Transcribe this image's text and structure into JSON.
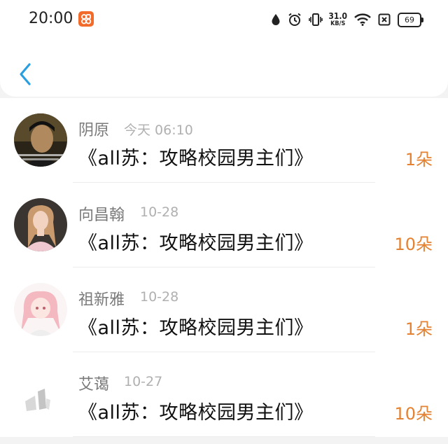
{
  "status_bar": {
    "time": "20:00",
    "net_speed_value": "31.0",
    "net_speed_unit": "KB/S",
    "battery": "69",
    "icons": [
      "app-icon",
      "water-drop-icon",
      "alarm-icon",
      "vibrate-icon",
      "wifi-icon",
      "sim-off-icon",
      "battery-icon"
    ],
    "app_icon_color": "#f26b2a"
  },
  "nav": {
    "back_icon": "chevron-left-icon",
    "accent": "#2a9fe0"
  },
  "records": [
    {
      "name": "阴原",
      "date": "今天 06:10",
      "book": "《all苏：攻略校园男主们》",
      "count": "1朵"
    },
    {
      "name": "向昌翰",
      "date": "10-28",
      "book": "《all苏：攻略校园男主们》",
      "count": "10朵"
    },
    {
      "name": "祖新雅",
      "date": "10-28",
      "book": "《all苏：攻略校园男主们》",
      "count": "1朵"
    },
    {
      "name": "艾蔼",
      "date": "10-27",
      "book": "《all苏：攻略校园男主们》",
      "count": "10朵"
    }
  ],
  "colors": {
    "count": "#e58232",
    "name": "#7a7a7a",
    "date": "#b0b0b0"
  }
}
